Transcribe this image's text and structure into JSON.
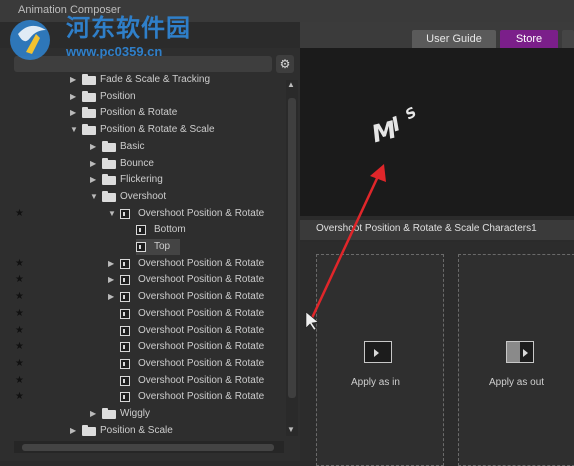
{
  "window": {
    "title": "Animation Composer"
  },
  "watermark": {
    "site": "河东软件园",
    "url": "www.pc0359.cn"
  },
  "header": {
    "user_guide": "User Guide",
    "store": "Store"
  },
  "tree": [
    {
      "label": "Fade & Scale & Tracking",
      "type": "folder",
      "indent": 1,
      "arrow": "right",
      "star": false,
      "selected": false
    },
    {
      "label": "Position",
      "type": "folder",
      "indent": 1,
      "arrow": "right",
      "star": false,
      "selected": false
    },
    {
      "label": "Position & Rotate",
      "type": "folder",
      "indent": 1,
      "arrow": "right",
      "star": false,
      "selected": false
    },
    {
      "label": "Position & Rotate & Scale",
      "type": "folder",
      "indent": 1,
      "arrow": "down",
      "star": false,
      "selected": false
    },
    {
      "label": "Basic",
      "type": "folder",
      "indent": 2,
      "arrow": "right",
      "star": false,
      "selected": false
    },
    {
      "label": "Bounce",
      "type": "folder",
      "indent": 2,
      "arrow": "right",
      "star": false,
      "selected": false
    },
    {
      "label": "Flickering",
      "type": "folder",
      "indent": 2,
      "arrow": "right",
      "star": false,
      "selected": false
    },
    {
      "label": "Overshoot",
      "type": "folder",
      "indent": 2,
      "arrow": "down",
      "star": false,
      "selected": false
    },
    {
      "label": "Overshoot Position & Rotate",
      "type": "file",
      "indent": 3,
      "arrow": "down",
      "star": true,
      "selected": false
    },
    {
      "label": "Bottom",
      "type": "file",
      "indent": 4,
      "arrow": "",
      "star": false,
      "selected": false
    },
    {
      "label": "Top",
      "type": "file",
      "indent": 4,
      "arrow": "",
      "star": false,
      "selected": true
    },
    {
      "label": "Overshoot Position & Rotate",
      "type": "file",
      "indent": 3,
      "arrow": "right",
      "star": true,
      "selected": false
    },
    {
      "label": "Overshoot Position & Rotate",
      "type": "file",
      "indent": 3,
      "arrow": "right",
      "star": true,
      "selected": false
    },
    {
      "label": "Overshoot Position & Rotate",
      "type": "file",
      "indent": 3,
      "arrow": "right",
      "star": true,
      "selected": false
    },
    {
      "label": "Overshoot Position & Rotate",
      "type": "file",
      "indent": 3,
      "arrow": "",
      "star": true,
      "selected": false
    },
    {
      "label": "Overshoot Position & Rotate",
      "type": "file",
      "indent": 3,
      "arrow": "",
      "star": true,
      "selected": false
    },
    {
      "label": "Overshoot Position & Rotate",
      "type": "file",
      "indent": 3,
      "arrow": "",
      "star": true,
      "selected": false
    },
    {
      "label": "Overshoot Position & Rotate",
      "type": "file",
      "indent": 3,
      "arrow": "",
      "star": true,
      "selected": false
    },
    {
      "label": "Overshoot Position & Rotate",
      "type": "file",
      "indent": 3,
      "arrow": "",
      "star": true,
      "selected": false
    },
    {
      "label": "Overshoot Position & Rotate",
      "type": "file",
      "indent": 3,
      "arrow": "",
      "star": true,
      "selected": false
    },
    {
      "label": "Wiggly",
      "type": "folder",
      "indent": 2,
      "arrow": "right",
      "star": false,
      "selected": false
    },
    {
      "label": "Position & Scale",
      "type": "folder",
      "indent": 1,
      "arrow": "right",
      "star": false,
      "selected": false
    }
  ],
  "preview": {
    "text": "MIS"
  },
  "effect": {
    "name": "Overshoot Position & Rotate & Scale Characters1"
  },
  "apply": {
    "in_label": "Apply as in",
    "out_label": "Apply as out"
  },
  "colors": {
    "store": "#7b1f8a",
    "annotation": "#e0262a"
  }
}
